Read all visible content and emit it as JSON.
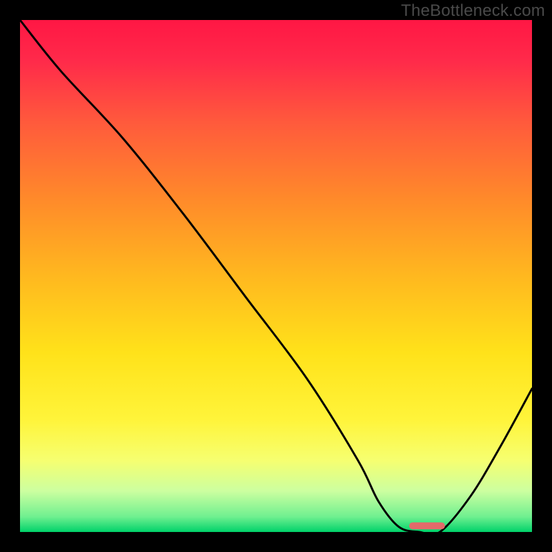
{
  "watermark": "TheBottleneck.com",
  "chart_data": {
    "type": "line",
    "title": "",
    "xlabel": "",
    "ylabel": "",
    "xlim": [
      0,
      100
    ],
    "ylim": [
      0,
      100
    ],
    "series": [
      {
        "name": "bottleneck-curve",
        "x": [
          0,
          8,
          20,
          32,
          44,
          56,
          66,
          70,
          74,
          78,
          82,
          88,
          94,
          100
        ],
        "y": [
          100,
          90,
          77,
          62,
          46,
          30,
          14,
          6,
          1,
          0,
          0,
          7,
          17,
          28
        ]
      }
    ],
    "marker": {
      "x_start": 76,
      "x_end": 83,
      "y": 1.2,
      "color": "#e26a6a"
    },
    "gradient_stops": [
      {
        "offset": 0.0,
        "color": "#ff1744"
      },
      {
        "offset": 0.08,
        "color": "#ff2a4a"
      },
      {
        "offset": 0.2,
        "color": "#ff5a3c"
      },
      {
        "offset": 0.35,
        "color": "#ff8a2a"
      },
      {
        "offset": 0.5,
        "color": "#ffb81f"
      },
      {
        "offset": 0.65,
        "color": "#ffe21a"
      },
      {
        "offset": 0.78,
        "color": "#fff43a"
      },
      {
        "offset": 0.86,
        "color": "#f6ff70"
      },
      {
        "offset": 0.92,
        "color": "#ccffa0"
      },
      {
        "offset": 0.97,
        "color": "#70f090"
      },
      {
        "offset": 1.0,
        "color": "#00d26a"
      }
    ]
  }
}
